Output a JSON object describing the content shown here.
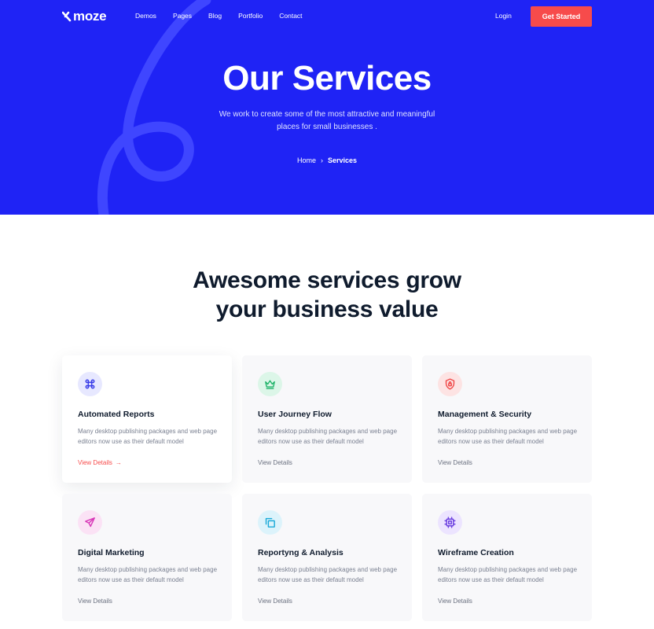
{
  "nav": {
    "logo": "moze",
    "links": [
      "Demos",
      "Pages",
      "Blog",
      "Portfolio",
      "Contact"
    ],
    "login": "Login",
    "cta": "Get Started"
  },
  "hero": {
    "title": "Our Services",
    "subtitle": "We work to create some of the most attractive and meaningful places for small businesses .",
    "breadcrumb": {
      "home": "Home",
      "separator": "›",
      "current": "Services"
    }
  },
  "section": {
    "title_line1": "Awesome services grow",
    "title_line2": "your business value"
  },
  "services": [
    {
      "title": "Automated Reports",
      "desc": "Many desktop publishing packages and web page editors now use as their default model",
      "link": "View Details",
      "icon": "command-icon",
      "icon_color": "#3b3fe8",
      "icon_bg": "#e7e8ff"
    },
    {
      "title": "User Journey Flow",
      "desc": "Many desktop publishing packages and web page editors now use as their default model",
      "link": "View Details",
      "icon": "crown-icon",
      "icon_color": "#21b46a",
      "icon_bg": "#dcf6e8"
    },
    {
      "title": "Management & Security",
      "desc": "Many desktop publishing packages and web page editors now use as their default model",
      "link": "View Details",
      "icon": "shield-lock-icon",
      "icon_color": "#f04848",
      "icon_bg": "#fde3e3"
    },
    {
      "title": "Digital Marketing",
      "desc": "Many desktop publishing packages and web page editors now use as their default model",
      "link": "View Details",
      "icon": "send-icon",
      "icon_color": "#d838b8",
      "icon_bg": "#fbe2f5"
    },
    {
      "title": "Reportyng & Analysis",
      "desc": "Many desktop publishing packages and web page editors now use as their default model",
      "link": "View Details",
      "icon": "copy-icon",
      "icon_color": "#18a9d8",
      "icon_bg": "#dcf3fb"
    },
    {
      "title": "Wireframe Creation",
      "desc": "Many desktop publishing packages and web page editors now use as their default model",
      "link": "View Details",
      "icon": "cpu-icon",
      "icon_color": "#6b3fe0",
      "icon_bg": "#ece4ff"
    }
  ],
  "colors": {
    "hero_bg": "#1f23f5",
    "accent": "#f74b4b",
    "heading": "#0f1b2d"
  }
}
